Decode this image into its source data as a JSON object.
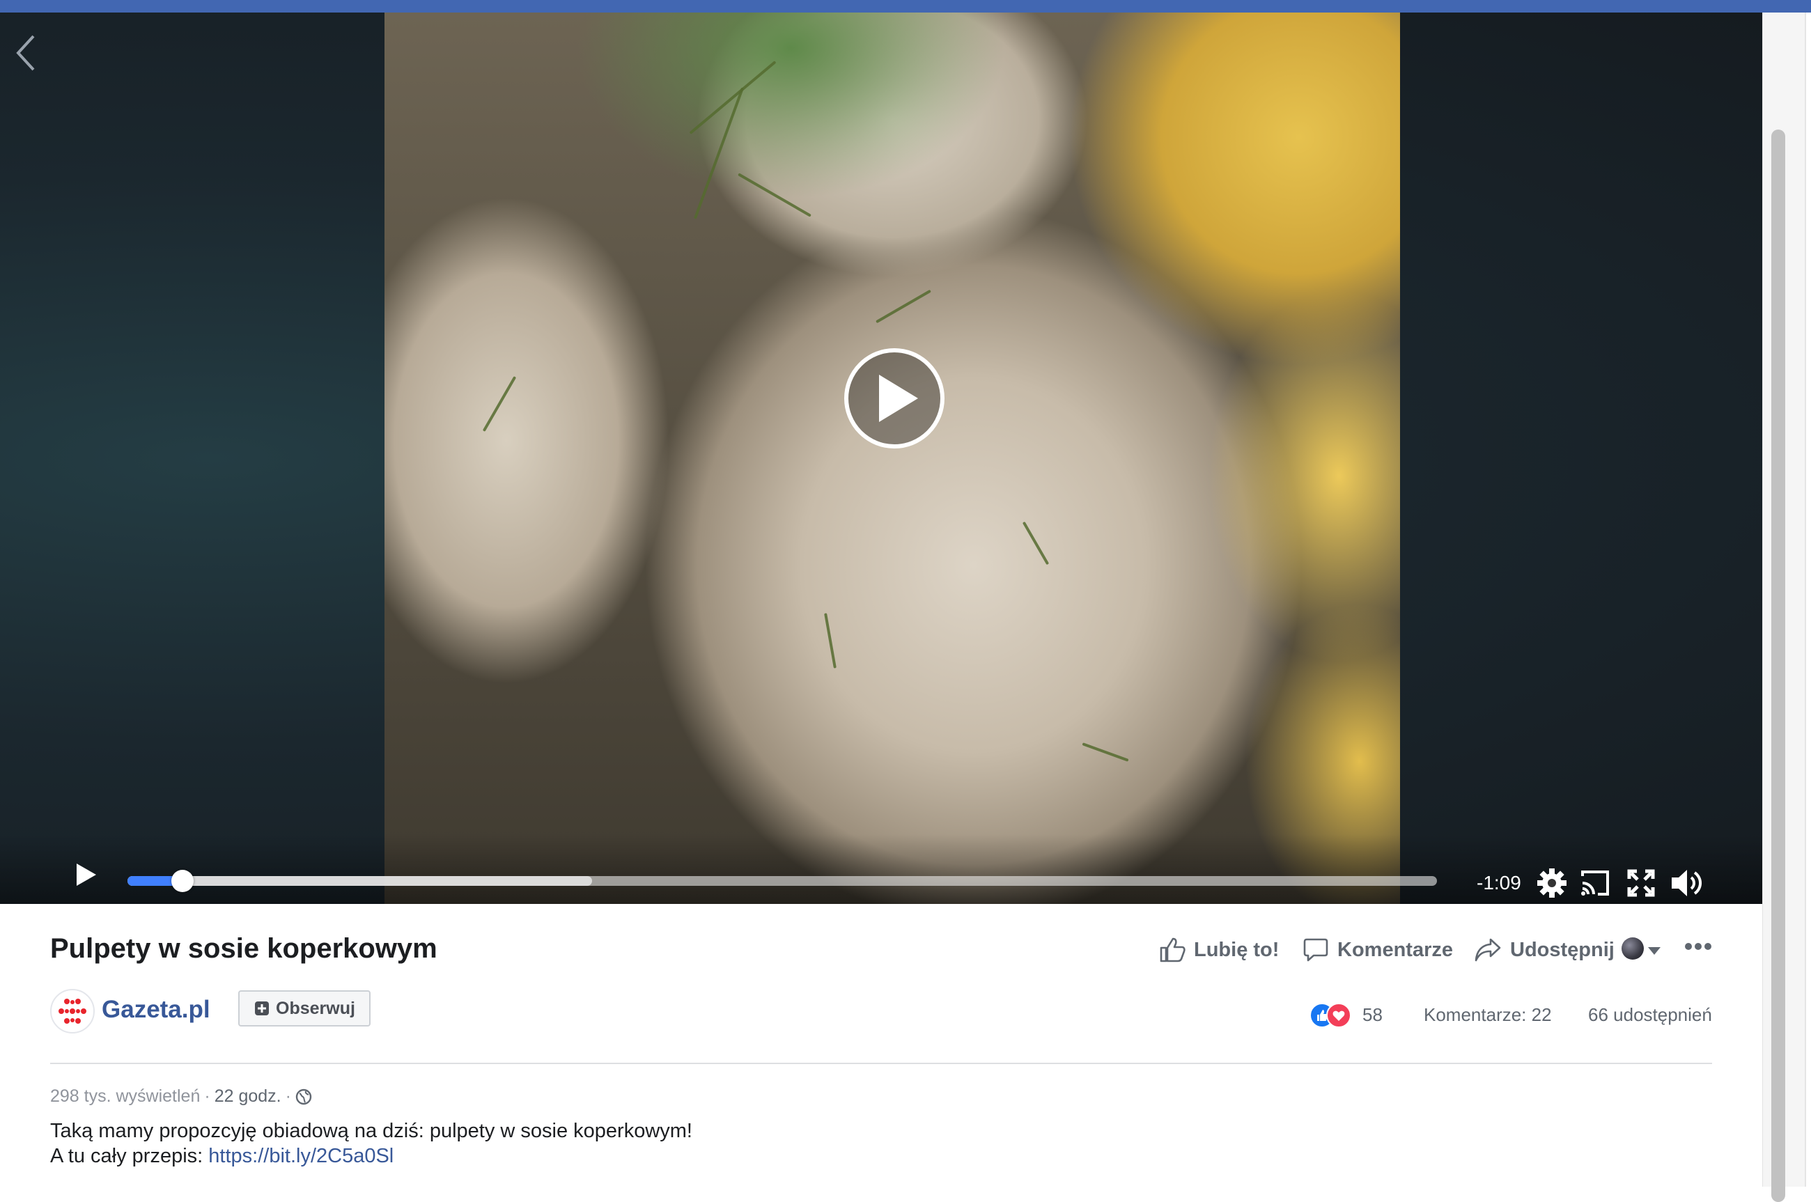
{
  "video": {
    "time_remaining": "-1:09",
    "progress_fraction": 0.042,
    "buffered_fraction": 0.355
  },
  "post": {
    "title": "Pulpety w sosie koperkowym",
    "actions": {
      "like": "Lubię to!",
      "comment": "Komentarze",
      "share": "Udostępnij"
    },
    "page": {
      "name": "Gazeta.pl",
      "follow_label": "Obserwuj"
    },
    "stats": {
      "reactions_count": "58",
      "comments": "Komentarze: 22",
      "shares": "66 udostępnień"
    },
    "meta": {
      "views": "298 tys. wyświetleń",
      "time": "22 godz.",
      "separator": "·"
    },
    "description": {
      "line1": "Taką mamy propozcyję obiadową na dziś: pulpety w sosie koperkowym!",
      "line2_prefix": "A tu cały przepis: ",
      "link": "https://bit.ly/2C5a0Sl"
    }
  },
  "colors": {
    "brand_blue": "#4267b2",
    "link_blue": "#385898",
    "progress_blue": "#4080ff",
    "like_blue": "#1877f2",
    "love_red": "#f33e58",
    "logo_red": "#e8242c"
  }
}
